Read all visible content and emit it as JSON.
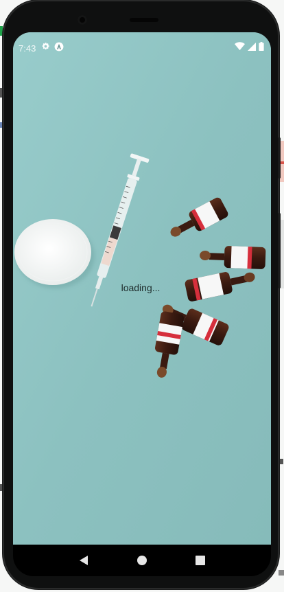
{
  "status_bar": {
    "time": "7:43",
    "left_icons": [
      "settings-gear-icon",
      "app-notification-icon"
    ],
    "right_icons": [
      "wifi-icon",
      "cellular-signal-icon",
      "battery-icon"
    ]
  },
  "main": {
    "loading_text": "loading..."
  },
  "navigation": {
    "buttons": [
      "back-button",
      "home-button",
      "recents-button"
    ]
  },
  "colors": {
    "wallpaper": "#8fc3c2",
    "phone_frame": "#0f1010",
    "nav_bar": "#000000"
  }
}
